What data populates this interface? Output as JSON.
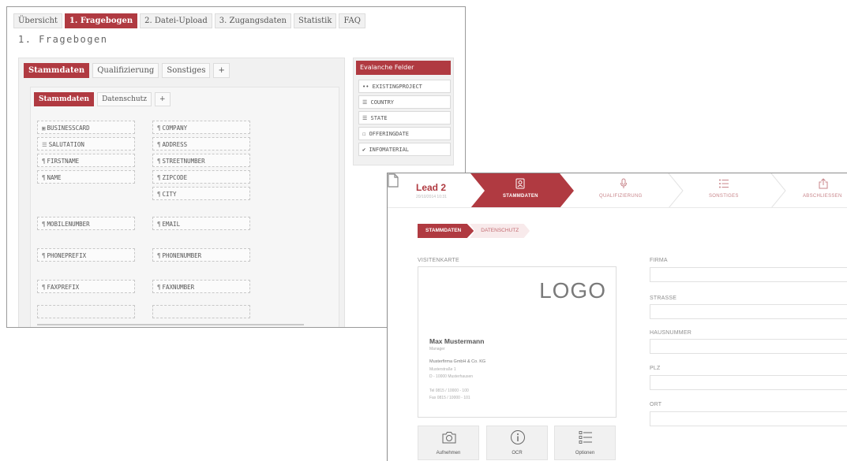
{
  "builder": {
    "top_tabs": [
      {
        "label": "Übersicht",
        "active": false
      },
      {
        "label": "1. Fragebogen",
        "active": true
      },
      {
        "label": "2. Datei-Upload",
        "active": false
      },
      {
        "label": "3. Zugangsdaten",
        "active": false
      },
      {
        "label": "Statistik",
        "active": false
      },
      {
        "label": "FAQ",
        "active": false
      }
    ],
    "heading": "1. Fragebogen",
    "section_tabs": [
      {
        "label": "Stammdaten",
        "active": true
      },
      {
        "label": "Qualifizierung",
        "active": false
      },
      {
        "label": "Sonstiges",
        "active": false
      },
      {
        "label": "+",
        "active": false
      }
    ],
    "sub_tabs": [
      {
        "label": "Stammdaten",
        "active": true
      },
      {
        "label": "Datenschutz",
        "active": false
      },
      {
        "label": "+",
        "active": false
      }
    ],
    "fields_left": [
      {
        "icon": "▣",
        "label": "BUSINESSCARD"
      },
      {
        "icon": "☰",
        "label": "SALUTATION"
      },
      {
        "icon": "¶",
        "label": "FIRSTNAME"
      },
      {
        "icon": "¶",
        "label": "NAME"
      },
      {
        "icon": "¶",
        "label": "MOBILENUMBER"
      },
      {
        "icon": "¶",
        "label": "PHONEPREFIX"
      },
      {
        "icon": "¶",
        "label": "FAXPREFIX"
      }
    ],
    "fields_right": [
      {
        "icon": "¶",
        "label": "COMPANY"
      },
      {
        "icon": "¶",
        "label": "ADDRESS"
      },
      {
        "icon": "¶",
        "label": "STREETNUMBER"
      },
      {
        "icon": "¶",
        "label": "ZIPCODE"
      },
      {
        "icon": "¶",
        "label": "CITY"
      },
      {
        "icon": "¶",
        "label": "EMAIL"
      },
      {
        "icon": "¶",
        "label": "PHONENUMBER"
      },
      {
        "icon": "¶",
        "label": "FAXNUMBER"
      }
    ],
    "sidebar": {
      "title": "Evalanche Felder",
      "items": [
        {
          "icon": "••",
          "label": "EXISTINGPROJECT"
        },
        {
          "icon": "☰",
          "label": "COUNTRY"
        },
        {
          "icon": "☰",
          "label": "STATE"
        },
        {
          "icon": "☐",
          "label": "OFFERINGDATE"
        },
        {
          "icon": "✔",
          "label": "INFOMATERIAL"
        }
      ]
    }
  },
  "app": {
    "lead_title": "Lead 2",
    "lead_date": "20/10/2014 10:31",
    "steps": [
      {
        "label": "STAMMDATEN",
        "icon": "contact-card-icon",
        "active": true
      },
      {
        "label": "QUALIFIZIERUNG",
        "icon": "microphone-icon",
        "active": false
      },
      {
        "label": "SONSTIGES",
        "icon": "list-icon",
        "active": false
      },
      {
        "label": "ABSCHLIESSEN",
        "icon": "share-icon",
        "active": false
      }
    ],
    "tabs": [
      {
        "label": "STAMMDATEN",
        "active": true
      },
      {
        "label": "DATENSCHUTZ",
        "active": false
      }
    ],
    "card_section_label": "VISITENKARTE",
    "card": {
      "logo": "LOGO",
      "name": "Max Mustermann",
      "role": "Manager",
      "company": "Musterfirma GmbH & Co. KG",
      "street": "Musterstraße 1",
      "city": "D - 10000 Musterhausen",
      "tel": "Tel   0815 / 10000 - 100",
      "fax": "Fax   0815 / 10000 - 101"
    },
    "actions": [
      {
        "label": "Aufnehmen",
        "icon": "camera-icon"
      },
      {
        "label": "OCR",
        "icon": "info-icon"
      },
      {
        "label": "Optionen",
        "icon": "options-list-icon"
      }
    ],
    "form_fields": [
      {
        "label": "FIRMA",
        "value": ""
      },
      {
        "label": "STRASSE",
        "value": ""
      },
      {
        "label": "HAUSNUMMER",
        "value": ""
      },
      {
        "label": "PLZ",
        "value": ""
      },
      {
        "label": "ORT",
        "value": ""
      }
    ],
    "colors": {
      "accent": "#b03a41",
      "accent_light": "#f8eaeb"
    }
  }
}
